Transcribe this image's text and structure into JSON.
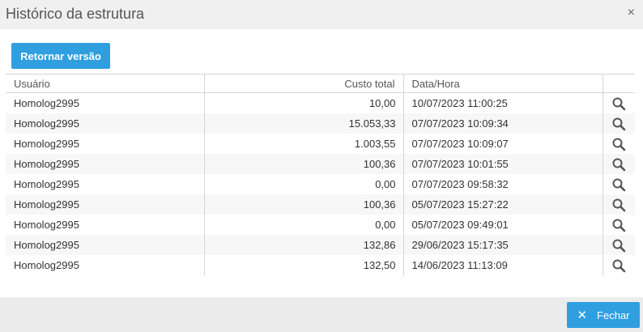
{
  "dialog": {
    "title": "Histórico da estrutura",
    "close_glyph": "×"
  },
  "toolbar": {
    "restore_label": "Retornar versão"
  },
  "table": {
    "columns": [
      "Usuário",
      "Custo total",
      "Data/Hora",
      ""
    ],
    "rows": [
      {
        "user": "Homolog2995",
        "cost": "10,00",
        "datetime": "10/07/2023 11:00:25"
      },
      {
        "user": "Homolog2995",
        "cost": "15.053,33",
        "datetime": "07/07/2023 10:09:34"
      },
      {
        "user": "Homolog2995",
        "cost": "1.003,55",
        "datetime": "07/07/2023 10:09:07"
      },
      {
        "user": "Homolog2995",
        "cost": "100,36",
        "datetime": "07/07/2023 10:01:55"
      },
      {
        "user": "Homolog2995",
        "cost": "0,00",
        "datetime": "07/07/2023 09:58:32"
      },
      {
        "user": "Homolog2995",
        "cost": "100,36",
        "datetime": "05/07/2023 15:27:22"
      },
      {
        "user": "Homolog2995",
        "cost": "0,00",
        "datetime": "05/07/2023 09:49:01"
      },
      {
        "user": "Homolog2995",
        "cost": "132,86",
        "datetime": "29/06/2023 15:17:35"
      },
      {
        "user": "Homolog2995",
        "cost": "132,50",
        "datetime": "14/06/2023 11:13:09"
      }
    ],
    "row_action_icon": "search-icon"
  },
  "footer": {
    "close_label": "Fechar",
    "close_icon": "close-icon",
    "close_glyph": "✕"
  },
  "colors": {
    "accent": "#2f9fe0",
    "header_bg": "#f0f0f0",
    "footer_bg": "#ececec"
  }
}
